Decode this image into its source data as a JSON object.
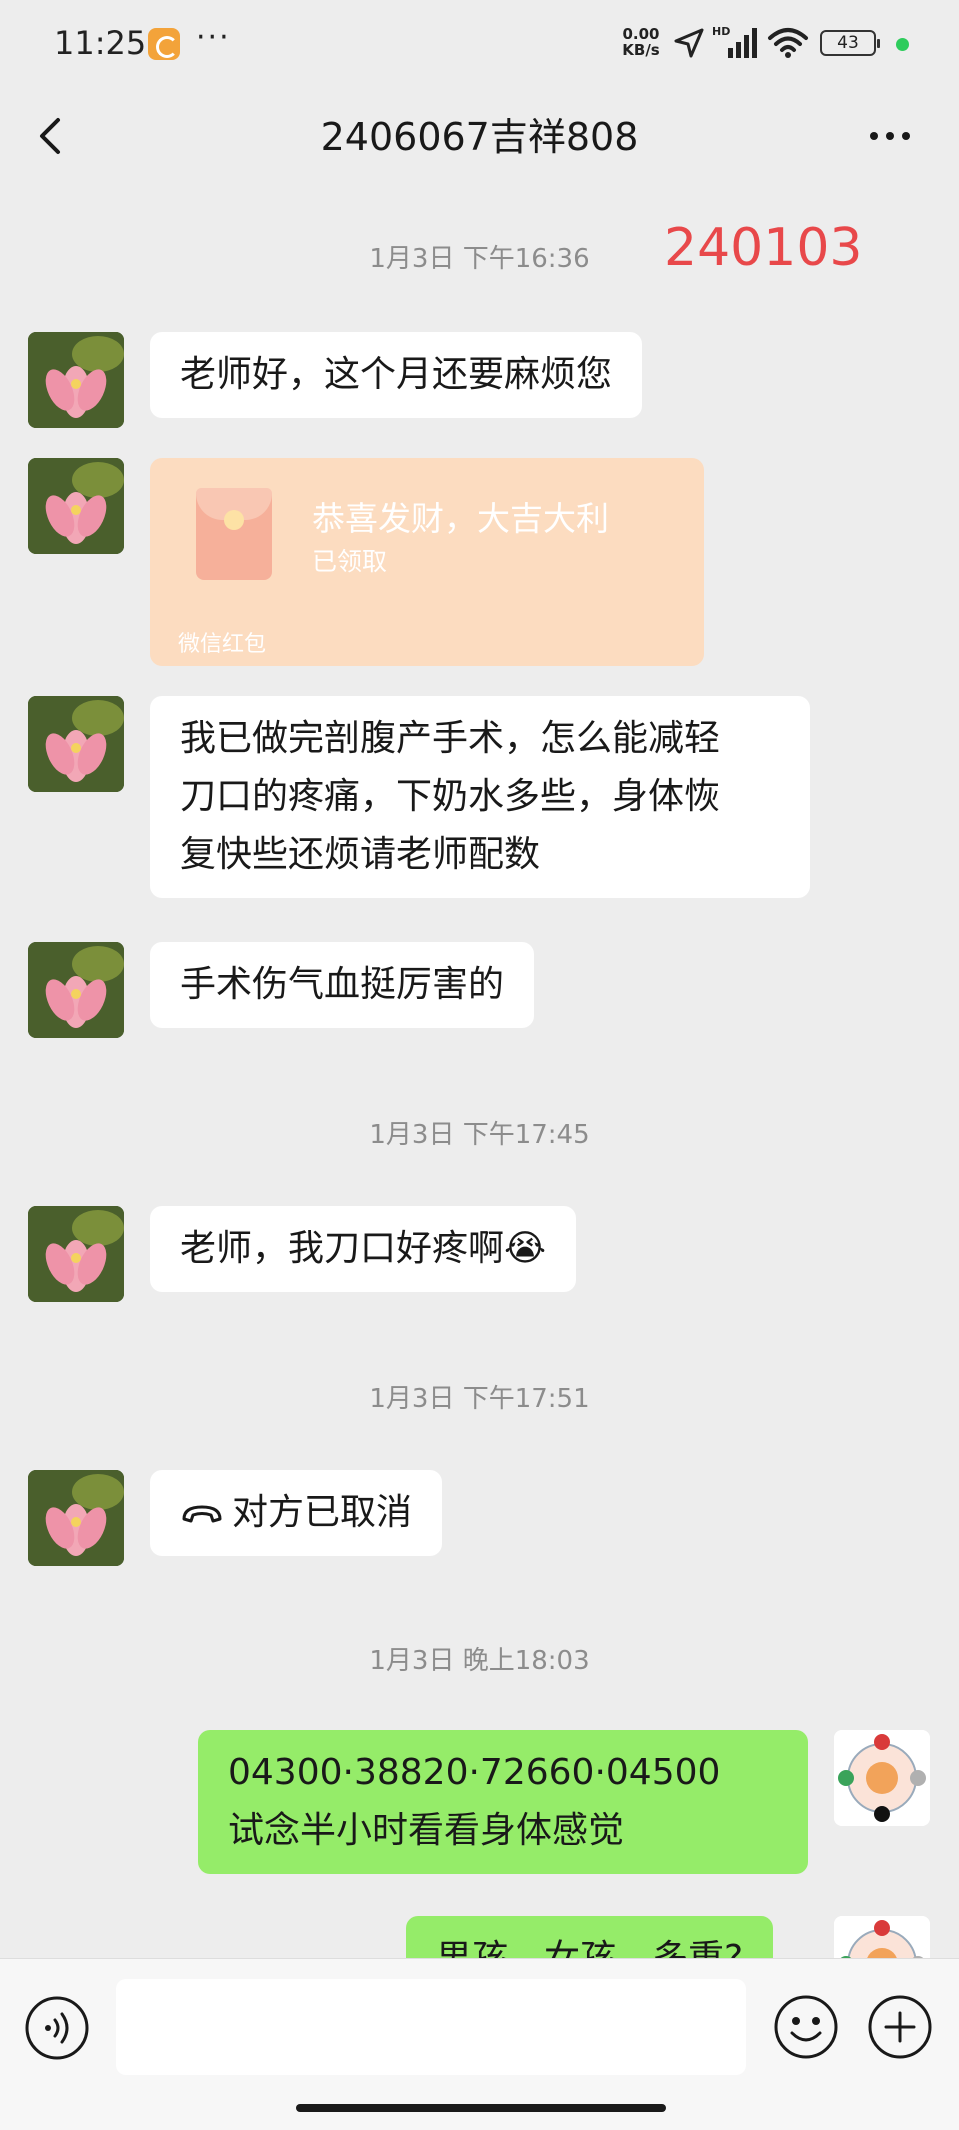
{
  "status_bar": {
    "time": "11:25",
    "more": "···",
    "speed": "0.00\nKB/s",
    "speed_value": "0.00",
    "speed_unit": "KB/s",
    "network": "HD",
    "battery": "43",
    "dot_color": "#2ecc5c"
  },
  "header": {
    "title": "2406067吉祥808",
    "back_icon": "chevron-left-icon",
    "more_icon": "more-dots-icon"
  },
  "annotation": "240103",
  "messages": [
    {
      "type": "time",
      "text": "1月3日 下午16:36"
    },
    {
      "type": "text",
      "side": "left",
      "text": "老师好，这个月还要麻烦您"
    },
    {
      "type": "red_packet",
      "side": "left",
      "title": "恭喜发财，大吉大利",
      "status": "已领取",
      "footer": "微信红包"
    },
    {
      "type": "text",
      "side": "left",
      "lines": [
        "我已做完剖腹产手术，怎么能减轻",
        "刀口的疼痛，下奶水多些，身体恢",
        "复快些还烦请老师配数"
      ]
    },
    {
      "type": "text",
      "side": "left",
      "text": "手术伤气血挺厉害的"
    },
    {
      "type": "time",
      "text": "1月3日 下午17:45"
    },
    {
      "type": "text",
      "side": "left",
      "text": "老师，我刀口好疼啊😭"
    },
    {
      "type": "time",
      "text": "1月3日 下午17:51"
    },
    {
      "type": "call",
      "side": "left",
      "text": "对方已取消",
      "icon": "phone-hangup-icon"
    },
    {
      "type": "time",
      "text": "1月3日 晚上18:03"
    },
    {
      "type": "text",
      "side": "right",
      "lines": [
        "04300·38820·72660·04500",
        "试念半小时看看身体感觉"
      ]
    },
    {
      "type": "text",
      "side": "right",
      "text": "男孩，女孩，多重?"
    }
  ],
  "input_bar": {
    "voice_icon": "voice-icon",
    "emoji_icon": "emoji-icon",
    "plus_icon": "plus-icon",
    "text_value": ""
  },
  "colors": {
    "background": "#ededed",
    "bubble_left": "#ffffff",
    "bubble_right": "#95ec69",
    "red_packet": "#fcdcc0",
    "annotation": "#e8484a"
  }
}
